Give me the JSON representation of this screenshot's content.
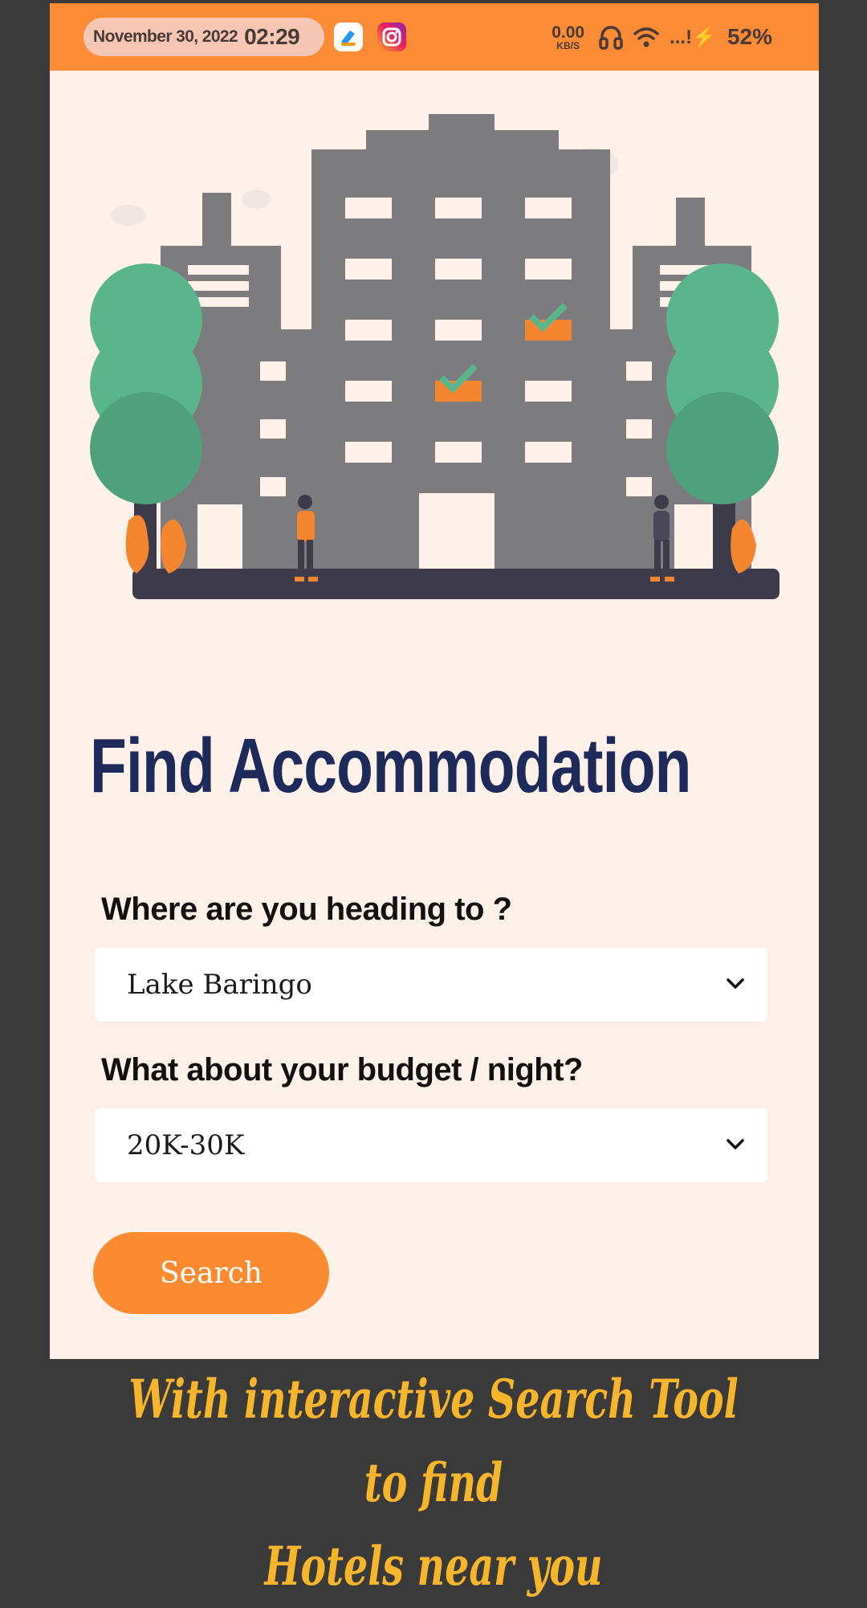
{
  "status_bar": {
    "date": "November 30, 2022",
    "time": "02:29",
    "net_speed_value": "0.00",
    "net_speed_unit": "KB/S",
    "signal_text": "...!⚡",
    "battery": "52%"
  },
  "main": {
    "title": "Find Accommodation",
    "destination": {
      "label": "Where are you heading to ?",
      "selected": "Lake Baringo"
    },
    "budget": {
      "label": "What about your budget / night?",
      "selected": "20K-30K"
    },
    "search_label": "Search"
  },
  "caption": {
    "line1": "With interactive Search Tool to find",
    "line2": "Hotels near you"
  },
  "colors": {
    "accent": "#fb8a30",
    "title": "#1e2a5a",
    "background": "#fdf1ea",
    "caption": "#f7b52b"
  },
  "icons": [
    "headphones-icon",
    "wifi-icon",
    "chevron-down-icon",
    "instagram-icon",
    "app-icon"
  ]
}
